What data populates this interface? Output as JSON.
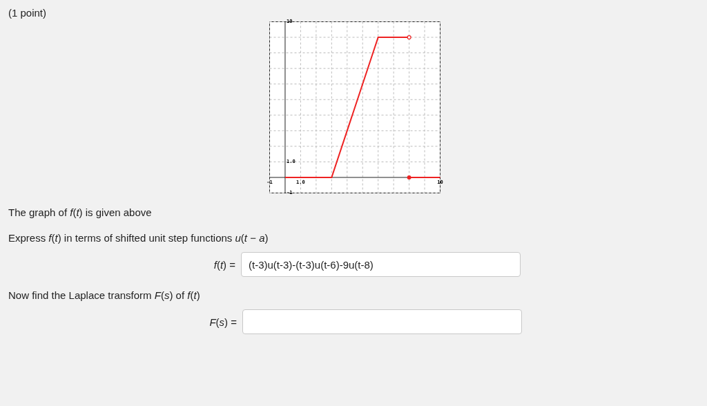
{
  "points": "(1 point)",
  "graph": {
    "chart_data": {
      "type": "line",
      "x": [
        0,
        3,
        6,
        8,
        8,
        10
      ],
      "xlim": [
        -1,
        10
      ],
      "ylim": [
        -1,
        10
      ],
      "xticks": [
        {
          "value": -1,
          "label": "-1"
        },
        {
          "value": 1,
          "label": "1.0"
        },
        {
          "value": 10,
          "label": "10"
        }
      ],
      "yticks": [
        {
          "value": -1,
          "label": "-1"
        },
        {
          "value": 1,
          "label": "1.0"
        },
        {
          "value": 10,
          "label": "10"
        }
      ],
      "series": [
        {
          "color": "#ee2222",
          "values": [
            0,
            0,
            9,
            9,
            null,
            null
          ]
        },
        {
          "color": "#ee2222",
          "values": [
            null,
            null,
            null,
            null,
            0,
            0
          ]
        }
      ]
    }
  },
  "statements": [
    "The graph of *f*(*t*) is given above",
    "Express *f*(*t*) in terms of shifted unit step functions *u*(*t* − *a*)"
  ],
  "answer_1": {
    "label": "*f*(*t*) =",
    "value": "(t-3)u(t-3)-(t-3)u(t-6)-9u(t-8)"
  },
  "statement_2": "Now find the Laplace transform *F*(*s*) of *f*(*t*)",
  "answer_2": {
    "label": "*F*(*s*) ="
  }
}
